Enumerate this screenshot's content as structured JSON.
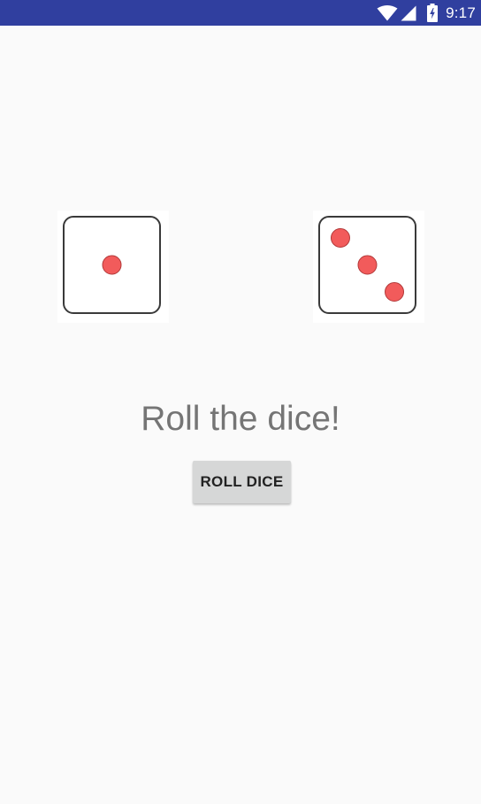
{
  "status_bar": {
    "time": "9:17",
    "icons": [
      "wifi-icon",
      "signal-icon",
      "battery-icon"
    ],
    "background": "#303f9f"
  },
  "dice": [
    {
      "name": "left-die",
      "value": 1
    },
    {
      "name": "right-die",
      "value": 3
    }
  ],
  "pip_color": "#f25b5b",
  "prompt": "Roll the dice!",
  "roll_button": {
    "label": "ROLL DICE"
  }
}
